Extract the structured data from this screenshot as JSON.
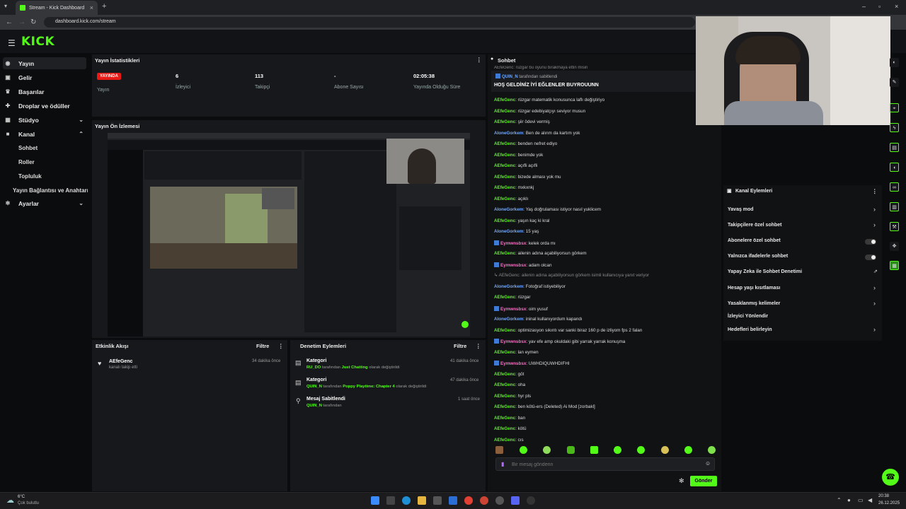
{
  "browser": {
    "tab_title": "Stream - Kick Dashboard",
    "url": "dashboard.kick.com/stream"
  },
  "app": {
    "logo": "KICK"
  },
  "sidebar": {
    "items": [
      {
        "label": "Yayın",
        "icon": "broadcast-icon"
      },
      {
        "label": "Gelir",
        "icon": "money-icon"
      },
      {
        "label": "Başarılar",
        "icon": "trophy-icon"
      },
      {
        "label": "Droplar ve ödüller",
        "icon": "gift-icon"
      },
      {
        "label": "Stüdyo",
        "icon": "studio-icon"
      },
      {
        "label": "Kanal",
        "icon": "channel-icon"
      },
      {
        "label": "Ayarlar",
        "icon": "gear-icon"
      }
    ],
    "kanal_sub": [
      "Sohbet",
      "Roller",
      "Topluluk"
    ],
    "connection_link": "Yayın Bağlantısı ve Anahtarı"
  },
  "stats": {
    "title": "Yayın İstatistikleri",
    "status_badge": "YAYINDA",
    "status_label": "Yayın",
    "viewers": {
      "value": "6",
      "label": "İzleyici"
    },
    "followers": {
      "value": "113",
      "label": "Takipçi"
    },
    "subs": {
      "value": "-",
      "label": "Abone Sayısı"
    },
    "uptime": {
      "value": "02:05:38",
      "label": "Yayında Olduğu Süre"
    }
  },
  "preview": {
    "title": "Yayın Ön İzlemesi"
  },
  "activity": {
    "title": "Etkinlik Akışı",
    "filter": "Filtre",
    "items": [
      {
        "user": "AEfeGenc",
        "text": "kanalı takip etti",
        "time": "34 dakika önce"
      }
    ]
  },
  "moderation": {
    "title": "Denetim Eylemleri",
    "filter": "Filtre",
    "items": [
      {
        "title": "Kategori",
        "user": "RU_DO",
        "mid": "tarafından",
        "highlight": "Just Chatting",
        "rest": "olarak değiştirildi",
        "time": "41 dakika önce"
      },
      {
        "title": "Kategori",
        "user": "QUIN_N",
        "mid": "tarafından",
        "highlight": "Poppy Playtime: Chapter 4",
        "rest": "olarak değiştirildi",
        "time": "47 dakika önce"
      },
      {
        "title": "Mesaj Sabitlendi",
        "user": "QUIN_N",
        "mid": "tarafından",
        "highlight": "",
        "rest": "",
        "time": "1 saat önce"
      }
    ]
  },
  "chat": {
    "title": "Sohbet",
    "top_partial": "AEfeGenc: rüzgar bu oyunu bırakmaya ettin misin",
    "pinned_by": "QUIN_N",
    "pinned_by_suffix": "tarafından sabitlendi",
    "pinned_message": "HOŞ GELDİNİZ İYİ EĞLENLER BUYROUUNN",
    "messages": [
      {
        "user": "AEfeGenc",
        "color": "g",
        "text": "rüzgar matematik konusunca laflı değiştiriyo"
      },
      {
        "user": "AEfeGenc",
        "color": "g",
        "text": "rüzgar edebiyatçıyı seviyor musun"
      },
      {
        "user": "AEfeGenc",
        "color": "g",
        "text": "şiir ödevi vermiş"
      },
      {
        "user": "AloneGorkem",
        "color": "b",
        "text": "Ben de alınm da kartım yok"
      },
      {
        "user": "AEfeGenc",
        "color": "g",
        "text": "benden nefret ediyo"
      },
      {
        "user": "AEfeGenc",
        "color": "g",
        "text": "benimde yok"
      },
      {
        "user": "AEfeGenc",
        "color": "g",
        "text": "açıfli açıfli"
      },
      {
        "user": "AEfeGenc",
        "color": "g",
        "text": "bizede alması yok mu"
      },
      {
        "user": "AEfeGenc",
        "color": "g",
        "text": "mxkxnkj"
      },
      {
        "user": "AEfeGenc",
        "color": "g",
        "text": "açıklı"
      },
      {
        "user": "AloneGorkem",
        "color": "b",
        "text": "Yaş doğrulaması istiyor nasıl yuklicem"
      },
      {
        "user": "AEfeGenc",
        "color": "g",
        "text": "yaşın kaç ki kral"
      },
      {
        "user": "AloneGorkem",
        "color": "b",
        "text": "15 yaş"
      },
      {
        "user": "Eymwnsbsx",
        "color": "p",
        "text": "kelek orda mı"
      },
      {
        "user": "AEfeGenc",
        "color": "g",
        "text": "ailenin adına açabiliyorsun görkem"
      },
      {
        "user": "Eymwnsbsx",
        "color": "p",
        "text": "adam olcan"
      },
      {
        "user": "",
        "color": "n",
        "text": "↳ AEfeGenc: ailenin adına açabiliyorsun görkem isimli kullanıcıya yanıt veriyor"
      },
      {
        "user": "AloneGorkem",
        "color": "b",
        "text": "Fotoğraf istiyebiliyor"
      },
      {
        "user": "AEfeGenc",
        "color": "g",
        "text": "rüzgar"
      },
      {
        "user": "Eymwnsbsx",
        "color": "p",
        "text": "oim yusuf"
      },
      {
        "user": "AloneGorkem",
        "color": "b",
        "text": "ininal kullanıyordum kapandı"
      },
      {
        "user": "AEfeGenc",
        "color": "g",
        "text": "optimizasyon sıkıntı var sanki biraz 160 p de izliyom fps 2 falan"
      },
      {
        "user": "Eymwnsbsx",
        "color": "p",
        "text": "yav efe amp okuldaki gibi yarrak yarrak konuşma"
      },
      {
        "user": "AEfeGenc",
        "color": "g",
        "text": "lan eymen"
      },
      {
        "user": "Eymwnsbsx",
        "color": "p",
        "text": "UWHDIQUWHDIFHI"
      },
      {
        "user": "AEfeGenc",
        "color": "g",
        "text": "göt"
      },
      {
        "user": "AEfeGenc",
        "color": "g",
        "text": "oha"
      },
      {
        "user": "AEfeGenc",
        "color": "g",
        "text": "hyr pls"
      },
      {
        "user": "AEfeGenc",
        "color": "g",
        "text": "ben kötü-ers (Deleted) Ai Mod [zorbakl]"
      },
      {
        "user": "AEfeGenc",
        "color": "g",
        "text": "ban"
      },
      {
        "user": "AEfeGenc",
        "color": "g",
        "text": "kötü"
      },
      {
        "user": "AEfeGenc",
        "color": "g",
        "text": "cıs"
      }
    ],
    "input_placeholder": "Bir mesaj gönderin",
    "send_label": "Gönder"
  },
  "channel_actions": {
    "title": "Kanal Eylemleri",
    "items": [
      {
        "label": "Yavaş mod",
        "control": "arrow"
      },
      {
        "label": "Takipçilere özel sohbet",
        "control": "arrow"
      },
      {
        "label": "Abonelere özel sohbet",
        "control": "toggle"
      },
      {
        "label": "Yalnızca ifadelerle sohbet",
        "control": "toggle"
      },
      {
        "label": "Yapay Zeka ile Sohbet Denetimi",
        "control": "external"
      },
      {
        "label": "Hesap yaşı kısıtlaması",
        "control": "arrow"
      },
      {
        "label": "Yasaklanmış kelimeler",
        "control": "arrow"
      },
      {
        "label": "İzleyici Yönlendir",
        "control": "none"
      },
      {
        "label": "Hedefleri belirleyin",
        "control": "arrow"
      }
    ]
  },
  "taskbar": {
    "weather_temp": "6°C",
    "weather_desc": "Çok bulutlu",
    "time": "20:38",
    "date": "26.12.2025"
  },
  "colors": {
    "accent": "#53fc18",
    "live": "#e91916",
    "panel": "#17181b",
    "bg": "#0b0c0d"
  }
}
